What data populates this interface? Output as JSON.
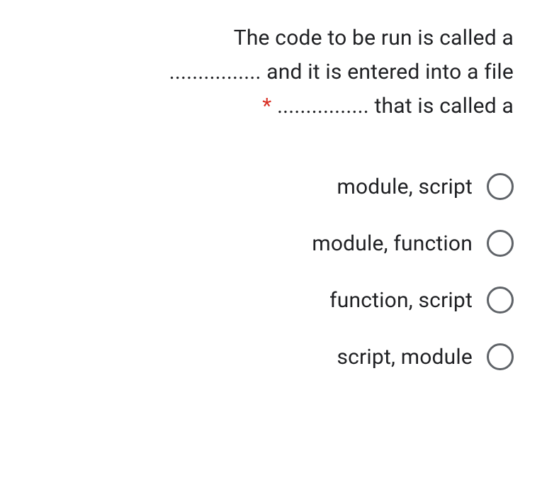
{
  "question": {
    "line1": "The code to be run is called a",
    "line2_prefix": "................ and it is entered into a file",
    "line3_prefix": "................ that is called a",
    "required_marker": "*"
  },
  "options": [
    {
      "label": "module, script"
    },
    {
      "label": "module, function"
    },
    {
      "label": "function, script"
    },
    {
      "label": "script, module"
    }
  ]
}
